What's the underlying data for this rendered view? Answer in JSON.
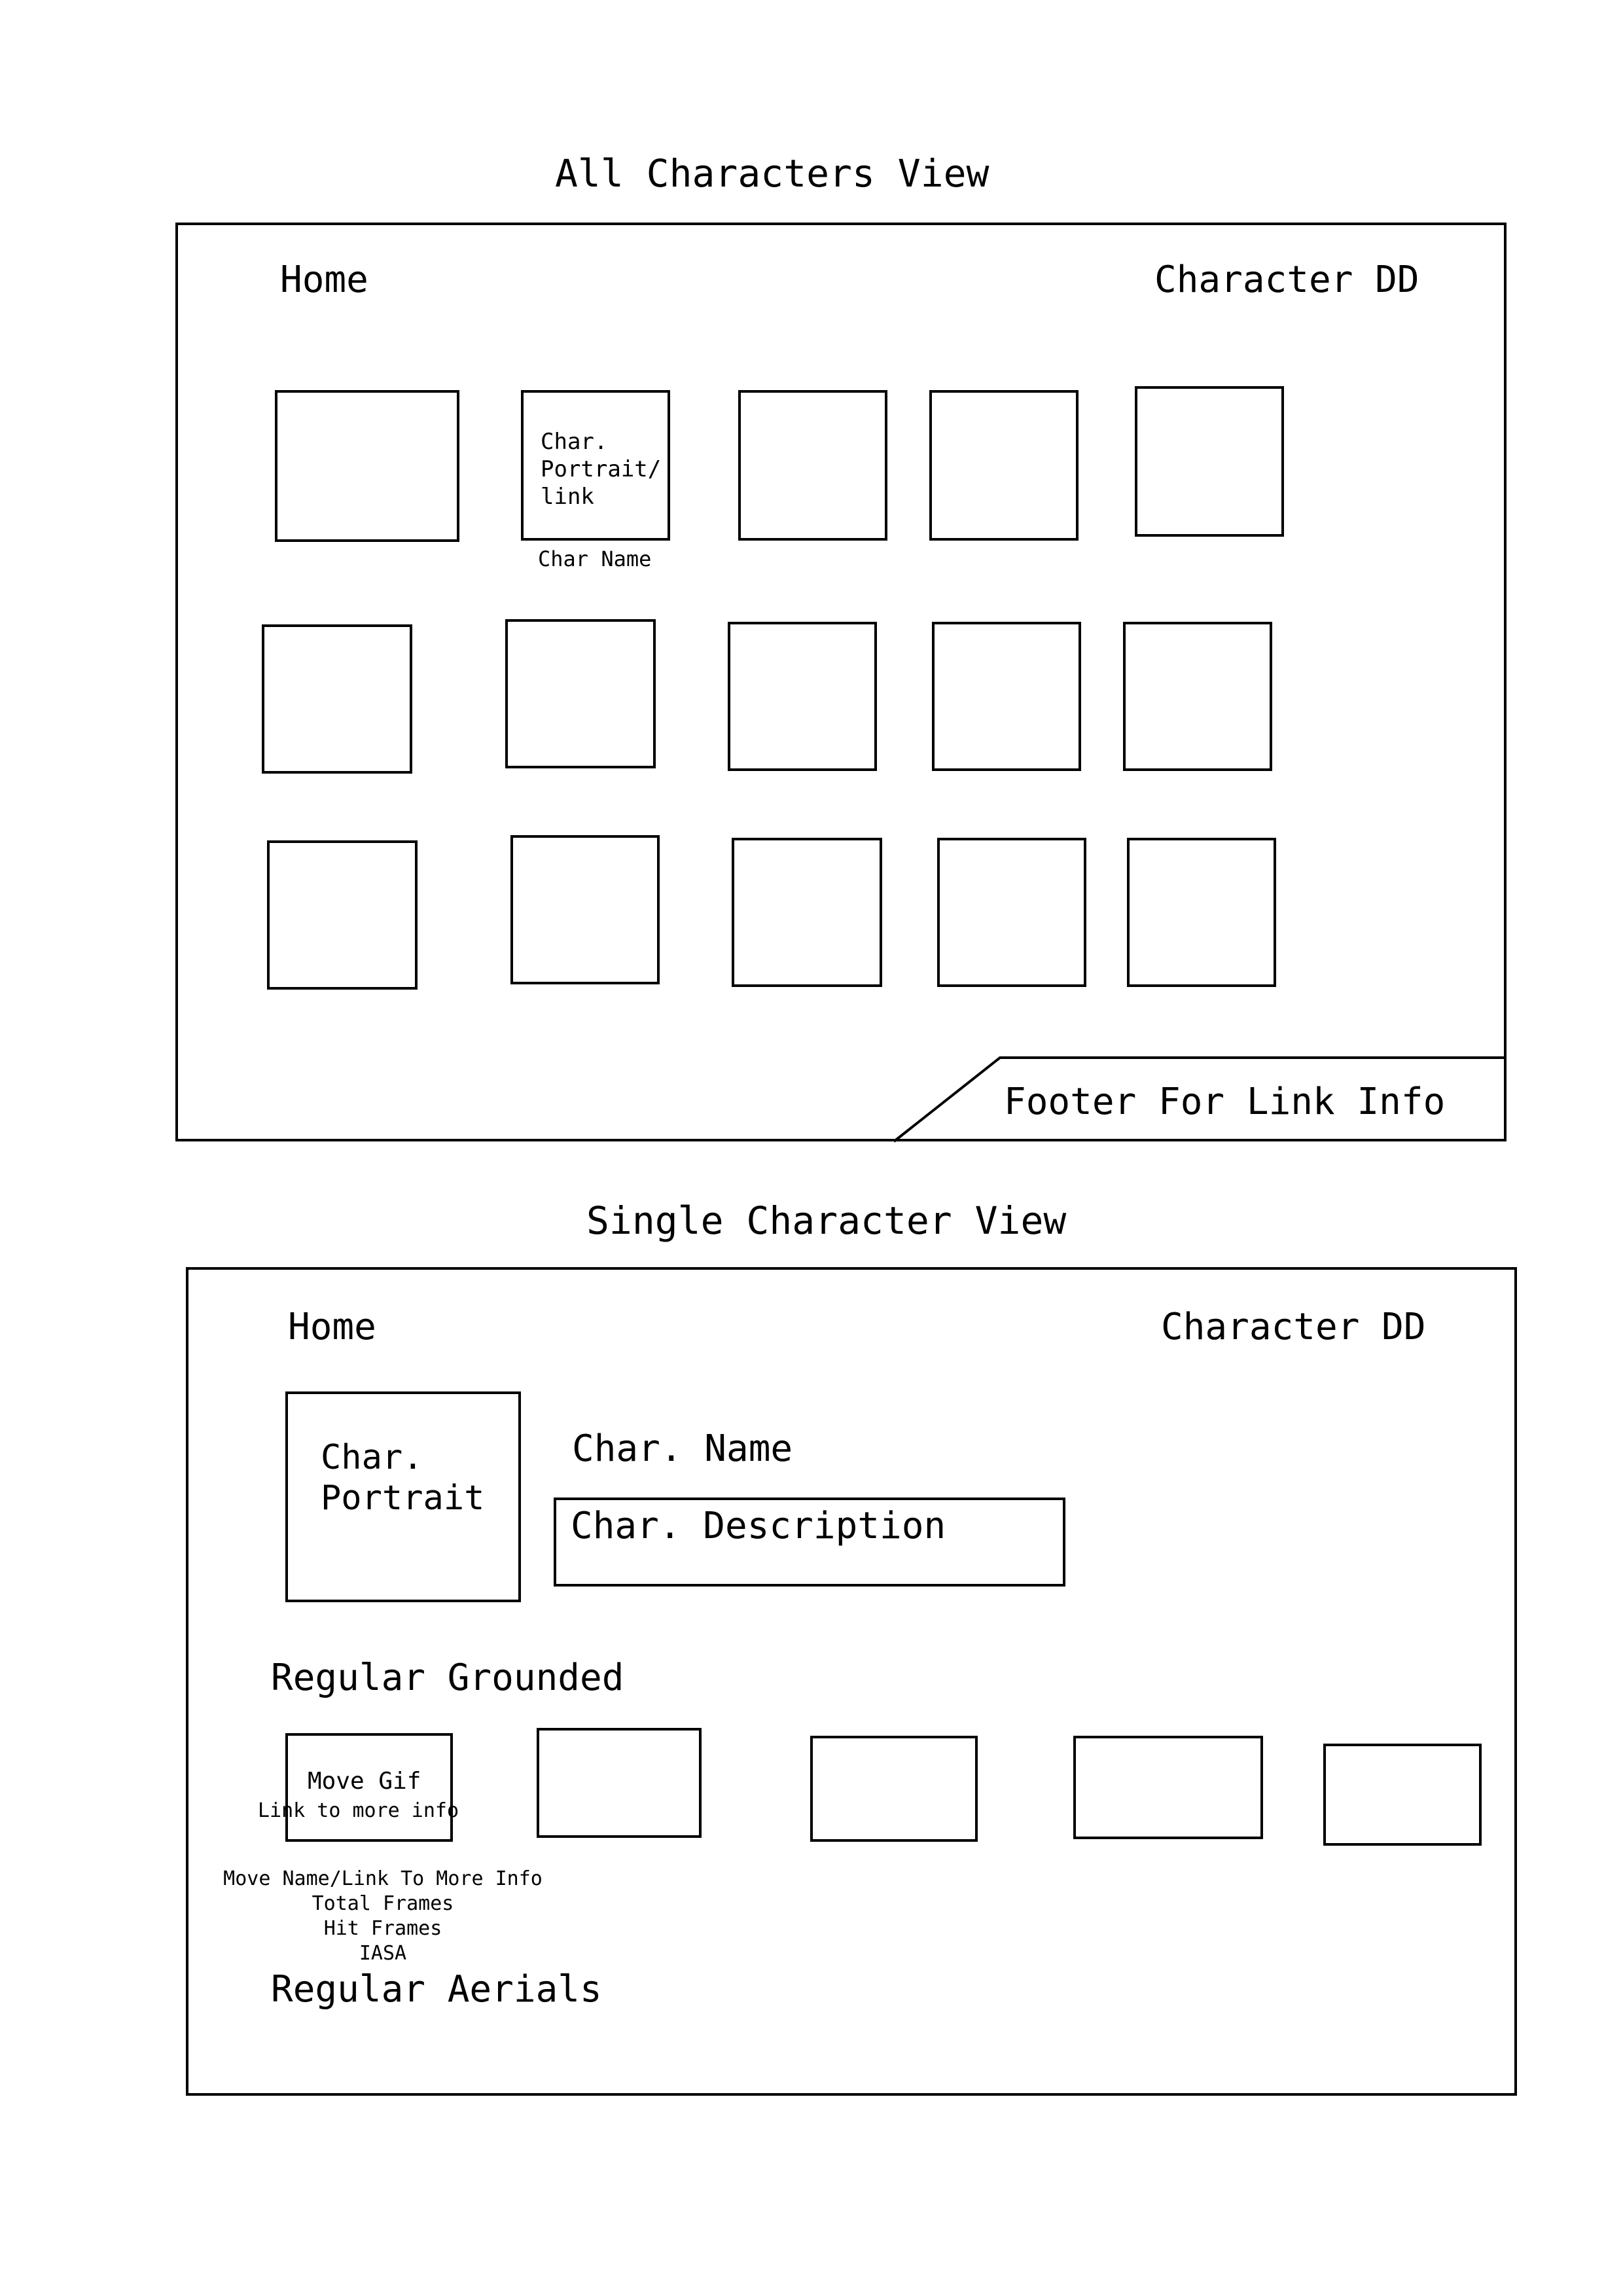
{
  "all_view": {
    "title": "All Characters View",
    "nav": {
      "home": "Home",
      "dropdown": "Character DD"
    },
    "portrait_label": "Char.\nPortrait/\nlink",
    "name_label": "Char Name",
    "footer_label": "Footer For Link Info"
  },
  "single_view": {
    "title": "Single Character View",
    "nav": {
      "home": "Home",
      "dropdown": "Character DD"
    },
    "portrait_label": "Char.\nPortrait",
    "name_label": "Char. Name",
    "description_label": "Char. Description",
    "grounded_heading": "Regular Grounded",
    "move_gif_label": "Move Gif",
    "move_link_label": "Link to more info",
    "move_info": {
      "name": "Move Name/Link To More Info",
      "total_frames": "Total Frames",
      "hit_frames": "Hit Frames",
      "iasa": "IASA"
    },
    "aerials_heading": "Regular Aerials"
  }
}
